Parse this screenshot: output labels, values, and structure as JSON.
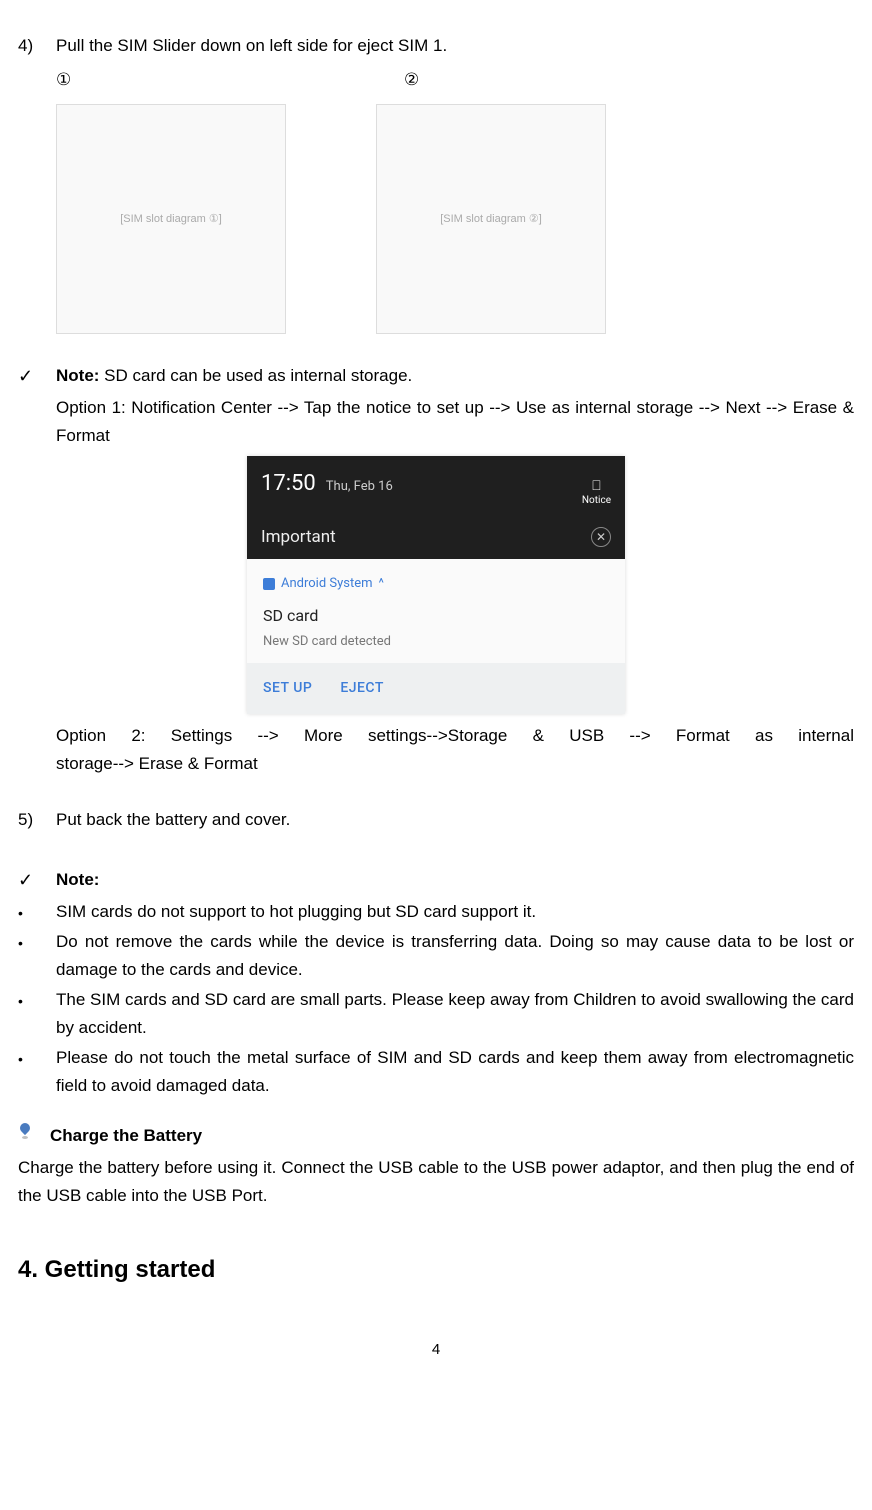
{
  "step4": {
    "num": "4)",
    "text": "Pull the SIM Slider down on left side for eject SIM 1.",
    "circled1": "①",
    "circled2": "②"
  },
  "note1": {
    "check": "✓",
    "label": "Note:",
    "text": " SD card can be used as internal storage.",
    "option1": "Option 1: Notification Center --> Tap the notice to set up --> Use as internal storage --> Next --> Erase & Format"
  },
  "screenshot": {
    "time": "17:50",
    "date": "Thu, Feb 16",
    "notice_label": "Notice",
    "important": "Important",
    "android_system": "Android System",
    "chevron": "^",
    "sd_title": "SD card",
    "sd_sub": "New SD card detected",
    "setup": "SET UP",
    "eject": "EJECT"
  },
  "option2_line1": "Option  2:  Settings  -->  More  settings-->Storage  &  USB  -->  Format  as  internal",
  "option2_line2": "storage--> Erase & Format",
  "step5": {
    "num": "5)",
    "text": "Put back the battery and cover."
  },
  "note2": {
    "check": "✓",
    "label": "Note:",
    "bullets": [
      "SIM cards do not support to hot plugging but SD card support it.",
      "Do not remove the cards while the device is transferring data. Doing so may cause data to be lost or damage to the cards and device.",
      "The SIM cards and SD card are small parts. Please keep away from Children to avoid swallowing the card by accident.",
      "Please do not touch the metal surface of SIM and SD cards and keep them away from electromagnetic field to avoid damaged data."
    ],
    "bullet_mark": "•"
  },
  "charge": {
    "title": "Charge the Battery",
    "text": "Charge the battery before using it. Connect the USB cable to the USB power adaptor, and then plug the end of the USB cable into the USB Port."
  },
  "section4": "4. Getting started",
  "page_number": "4",
  "diagram_label1": "[SIM slot diagram ①]",
  "diagram_label2": "[SIM slot diagram ②]"
}
